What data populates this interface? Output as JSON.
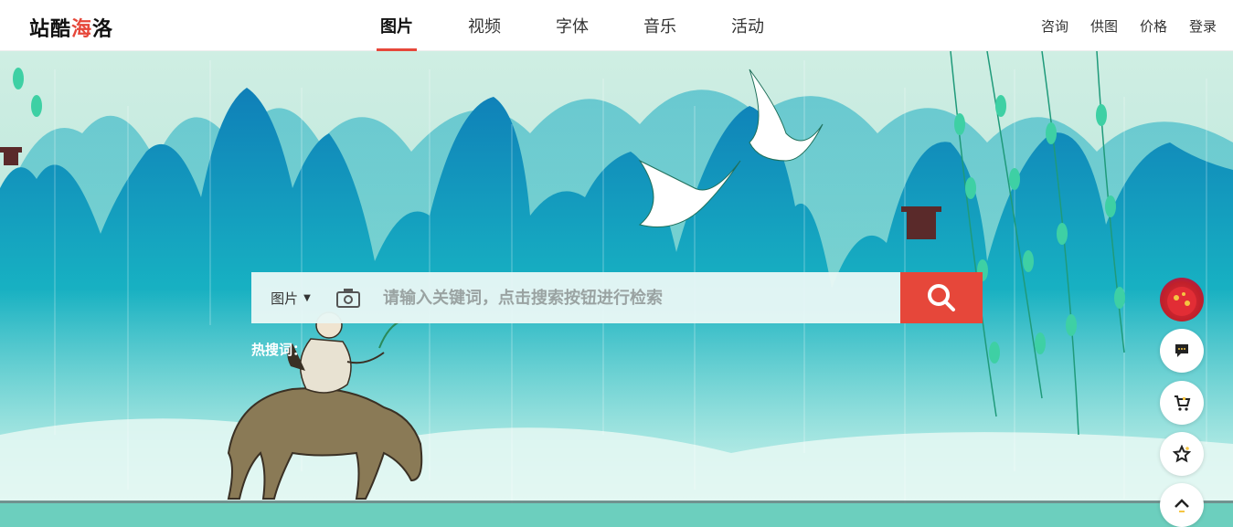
{
  "header": {
    "logo": {
      "part1": "站酷",
      "part2": "海",
      "part3": "洛"
    },
    "nav": [
      {
        "label": "图片",
        "active": true
      },
      {
        "label": "视频",
        "active": false
      },
      {
        "label": "字体",
        "active": false
      },
      {
        "label": "音乐",
        "active": false
      },
      {
        "label": "活动",
        "active": false
      }
    ],
    "links": [
      "咨询",
      "供图",
      "价格",
      "登录"
    ]
  },
  "search": {
    "category": "图片",
    "placeholder": "请输入关键词，点击搜索按钮进行检索",
    "hot_label": "热搜词："
  },
  "colors": {
    "accent": "#e6473a",
    "banner_teal": "#19b3b5"
  },
  "side_icons": [
    "avatar-icon",
    "chat-icon",
    "cart-icon",
    "star-icon",
    "up-arrow-icon"
  ]
}
